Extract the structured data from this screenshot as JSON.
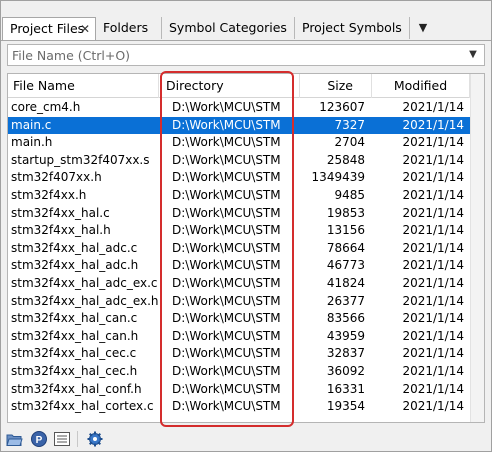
{
  "tabs": [
    {
      "label": "Project Files",
      "active": true
    },
    {
      "label": "Folders"
    },
    {
      "label": "Symbol Categories"
    },
    {
      "label": "Project Symbols"
    }
  ],
  "filter": {
    "placeholder": "File Name (Ctrl+O)"
  },
  "columns": {
    "name": "File Name",
    "directory": "Directory",
    "size": "Size",
    "modified": "Modified"
  },
  "rows": [
    {
      "name": "core_cm4.h",
      "dir": "D:\\Work\\MCU\\STM",
      "size": "123607",
      "modified": "2021/1/14"
    },
    {
      "name": "main.c",
      "dir": "D:\\Work\\MCU\\STM",
      "size": "7327",
      "modified": "2021/1/14",
      "selected": true
    },
    {
      "name": "main.h",
      "dir": "D:\\Work\\MCU\\STM",
      "size": "2704",
      "modified": "2021/1/14"
    },
    {
      "name": "startup_stm32f407xx.s",
      "dir": "D:\\Work\\MCU\\STM",
      "size": "25848",
      "modified": "2021/1/14"
    },
    {
      "name": "stm32f407xx.h",
      "dir": "D:\\Work\\MCU\\STM",
      "size": "1349439",
      "modified": "2021/1/14"
    },
    {
      "name": "stm32f4xx.h",
      "dir": "D:\\Work\\MCU\\STM",
      "size": "9485",
      "modified": "2021/1/14"
    },
    {
      "name": "stm32f4xx_hal.c",
      "dir": "D:\\Work\\MCU\\STM",
      "size": "19853",
      "modified": "2021/1/14"
    },
    {
      "name": "stm32f4xx_hal.h",
      "dir": "D:\\Work\\MCU\\STM",
      "size": "13156",
      "modified": "2021/1/14"
    },
    {
      "name": "stm32f4xx_hal_adc.c",
      "dir": "D:\\Work\\MCU\\STM",
      "size": "78664",
      "modified": "2021/1/14"
    },
    {
      "name": "stm32f4xx_hal_adc.h",
      "dir": "D:\\Work\\MCU\\STM",
      "size": "46773",
      "modified": "2021/1/14"
    },
    {
      "name": "stm32f4xx_hal_adc_ex.c",
      "dir": "D:\\Work\\MCU\\STM",
      "size": "41824",
      "modified": "2021/1/14"
    },
    {
      "name": "stm32f4xx_hal_adc_ex.h",
      "dir": "D:\\Work\\MCU\\STM",
      "size": "26377",
      "modified": "2021/1/14"
    },
    {
      "name": "stm32f4xx_hal_can.c",
      "dir": "D:\\Work\\MCU\\STM",
      "size": "83566",
      "modified": "2021/1/14"
    },
    {
      "name": "stm32f4xx_hal_can.h",
      "dir": "D:\\Work\\MCU\\STM",
      "size": "43959",
      "modified": "2021/1/14"
    },
    {
      "name": "stm32f4xx_hal_cec.c",
      "dir": "D:\\Work\\MCU\\STM",
      "size": "32837",
      "modified": "2021/1/14"
    },
    {
      "name": "stm32f4xx_hal_cec.h",
      "dir": "D:\\Work\\MCU\\STM",
      "size": "36092",
      "modified": "2021/1/14"
    },
    {
      "name": "stm32f4xx_hal_conf.h",
      "dir": "D:\\Work\\MCU\\STM",
      "size": "16331",
      "modified": "2021/1/14"
    },
    {
      "name": "stm32f4xx_hal_cortex.c",
      "dir": "D:\\Work\\MCU\\STM",
      "size": "19354",
      "modified": "2021/1/14"
    }
  ],
  "toolbar": {
    "icons": [
      "open-folder-icon",
      "project-icon",
      "list-view-icon",
      "settings-gear-icon"
    ]
  },
  "colors": {
    "selection": "#0a70d6",
    "highlight_box": "#d42d2d"
  }
}
